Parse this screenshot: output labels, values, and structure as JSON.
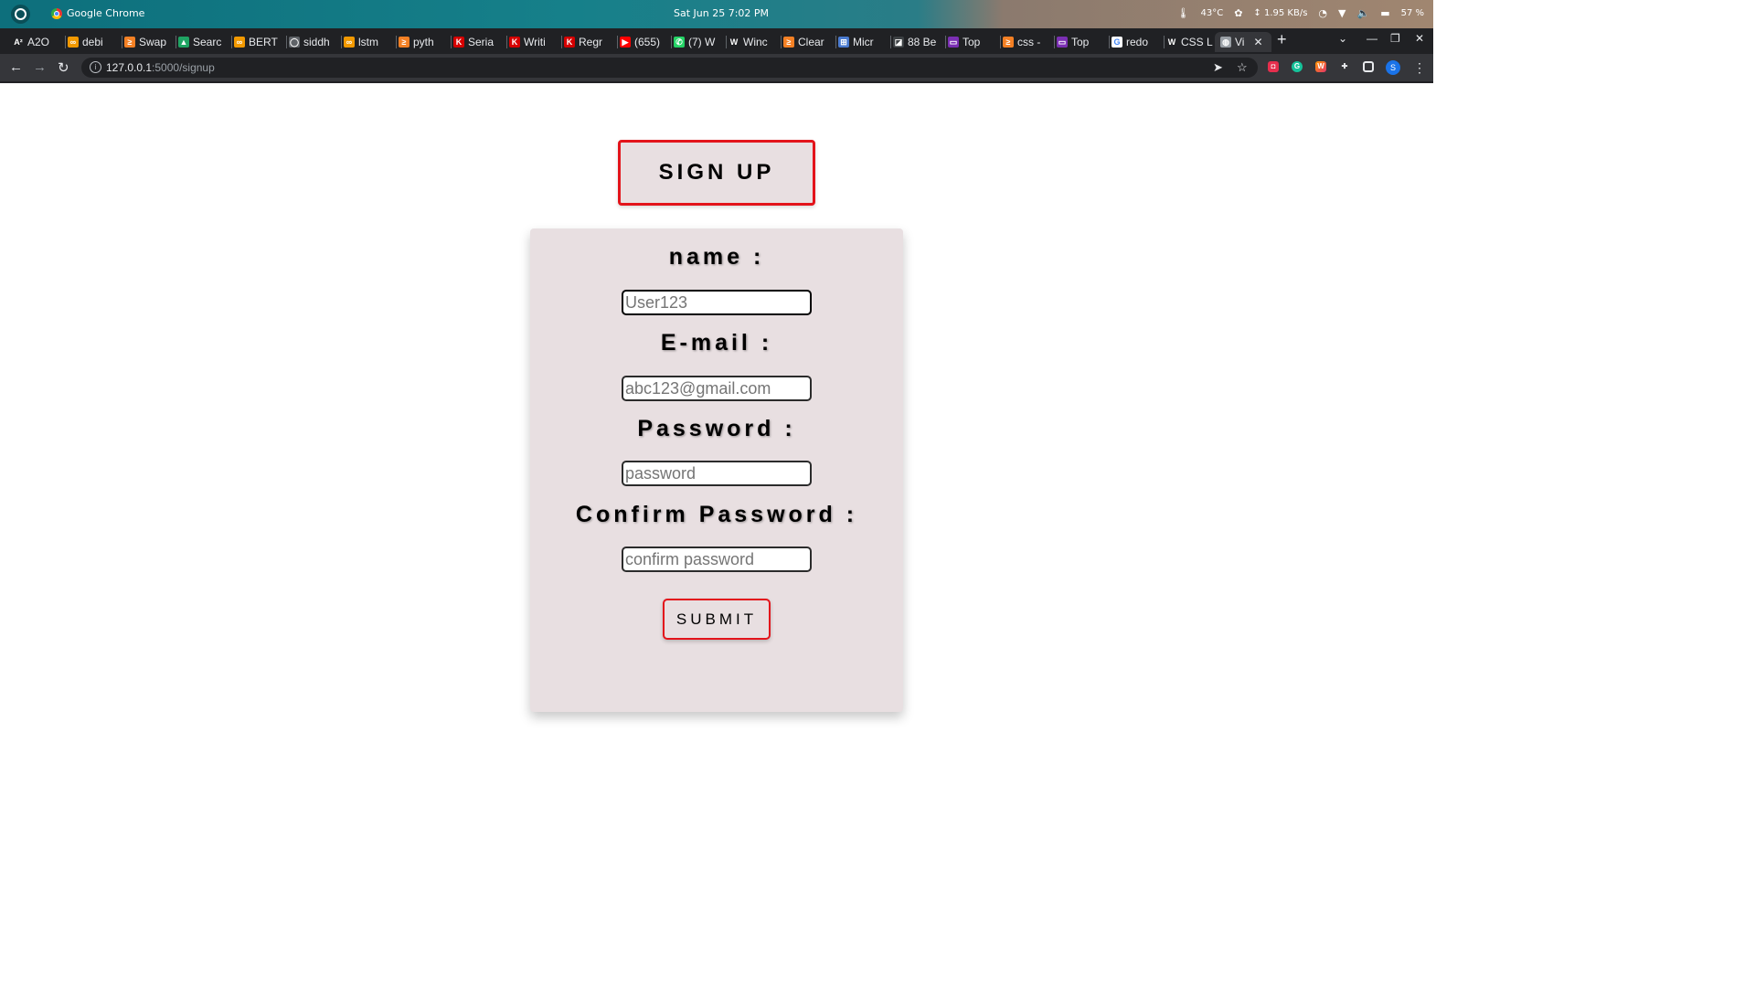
{
  "os": {
    "app_name": "Google Chrome",
    "clock": "Sat Jun 25   7:02 PM",
    "temperature": "43°C",
    "net_speed": "↕ 1.95 KB/s",
    "battery": "57 %"
  },
  "tabs": [
    {
      "label": "A2O",
      "favicon_color": "#202124",
      "favicon_text": "A²"
    },
    {
      "label": "debi",
      "favicon_color": "#f29900",
      "favicon_text": "∞"
    },
    {
      "label": "Swap",
      "favicon_color": "#f48024",
      "favicon_text": "≥"
    },
    {
      "label": "Searc",
      "favicon_color": "#1fa463",
      "favicon_text": "▲"
    },
    {
      "label": "BERT",
      "favicon_color": "#f29900",
      "favicon_text": "∞"
    },
    {
      "label": "siddh",
      "favicon_color": "#5f6368",
      "favicon_text": "◯"
    },
    {
      "label": "lstm",
      "favicon_color": "#f29900",
      "favicon_text": "∞"
    },
    {
      "label": "pyth",
      "favicon_color": "#f48024",
      "favicon_text": "≥"
    },
    {
      "label": "Seria",
      "favicon_color": "#d50000",
      "favicon_text": "K"
    },
    {
      "label": "Writi",
      "favicon_color": "#d50000",
      "favicon_text": "K"
    },
    {
      "label": "Regr",
      "favicon_color": "#d50000",
      "favicon_text": "K"
    },
    {
      "label": "(655)",
      "favicon_color": "#ff0000",
      "favicon_text": "▶"
    },
    {
      "label": "(7) W",
      "favicon_color": "#25d366",
      "favicon_text": "✆"
    },
    {
      "label": "Winc",
      "favicon_color": "#202124",
      "favicon_text": "W"
    },
    {
      "label": "Clear",
      "favicon_color": "#f48024",
      "favicon_text": "≥"
    },
    {
      "label": "Micr",
      "favicon_color": "#4a7bd0",
      "favicon_text": "⊞"
    },
    {
      "label": "88 Be",
      "favicon_color": "#3c4043",
      "favicon_text": "◪"
    },
    {
      "label": "Top",
      "favicon_color": "#7b2fb3",
      "favicon_text": "▭"
    },
    {
      "label": "css -",
      "favicon_color": "#f48024",
      "favicon_text": "≥"
    },
    {
      "label": "Top",
      "favicon_color": "#7b2fb3",
      "favicon_text": "▭"
    },
    {
      "label": "redo",
      "favicon_color": "#ffffff",
      "favicon_text": "G"
    },
    {
      "label": "CSS L",
      "favicon_color": "#202124",
      "favicon_text": "W"
    },
    {
      "label": "Vi",
      "favicon_color": "#9aa0a6",
      "favicon_text": "◍",
      "active": true
    }
  ],
  "address_bar": {
    "url_host": "127.0.0.1",
    "url_path": ":5000/signup"
  },
  "page": {
    "title": "SIGN UP",
    "fields": [
      {
        "label": "name :",
        "placeholder": "User123",
        "type": "text"
      },
      {
        "label": "E-mail :",
        "placeholder": "abc123@gmail.com",
        "type": "email"
      },
      {
        "label": "Password :",
        "placeholder": "password",
        "type": "password"
      },
      {
        "label": "Confirm Password :",
        "placeholder": "confirm password",
        "type": "password"
      }
    ],
    "submit_label": "SUBMIT"
  },
  "colors": {
    "accent_border": "#e3141b",
    "card_bg": "#e8dfe1"
  }
}
